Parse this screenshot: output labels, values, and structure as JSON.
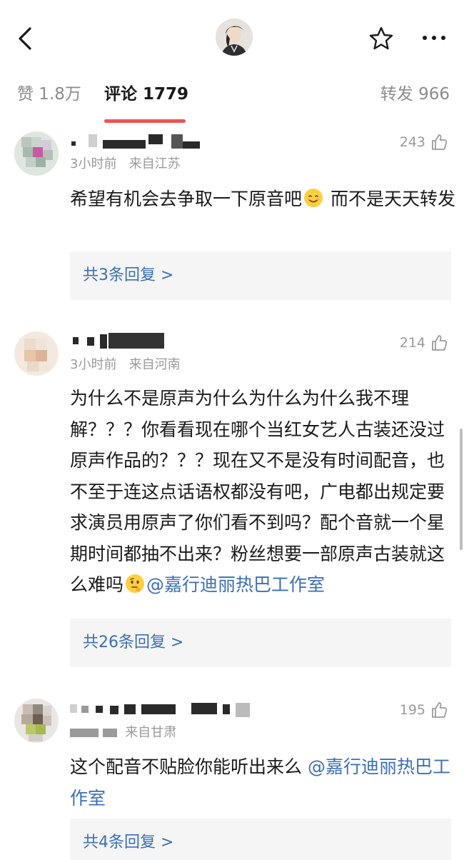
{
  "topbar": {
    "back_icon": "chevron-left-icon",
    "star_icon": "star-icon",
    "more_icon": "more-dots-icon"
  },
  "tabs": {
    "like": "赞 1.8万",
    "comment": "评论 1779",
    "repost": "转发 966"
  },
  "comments": [
    {
      "time": "3小时前",
      "location": "来自江苏",
      "likes": "243",
      "text": "希望有机会去争取一下原音吧",
      "emoji": "smiling-face-emoji",
      "text_after": " 而不是天天转发",
      "replies": "共3条回复 >"
    },
    {
      "time": "3小时前",
      "location": "来自河南",
      "likes": "214",
      "text": "为什么不是原声为什么为什么为什么我不理解？？？你看看现在哪个当红女艺人古装还没过原声作品的？？？现在又不是没有时间配音，也不至于连这点话语权都没有吧，广电都出规定要求演员用原声了你们看不到吗？配个音就一个星期时间都抽不出来？粉丝想要一部原声古装就这么难吗",
      "emoji": "thinking-face-emoji",
      "mention": "@嘉行迪丽热巴工作室",
      "replies": "共26条回复 >"
    },
    {
      "time": "",
      "location": "来自甘肃",
      "likes": "195",
      "text": "这个配音不贴脸你能听出来么 ",
      "mention": "@嘉行迪丽热巴工作室",
      "replies": "共4条回复 >"
    }
  ],
  "colors": {
    "accent_red": "#ef5454",
    "link_blue": "#3b6fb6",
    "muted_gray": "#9a9a9a"
  }
}
